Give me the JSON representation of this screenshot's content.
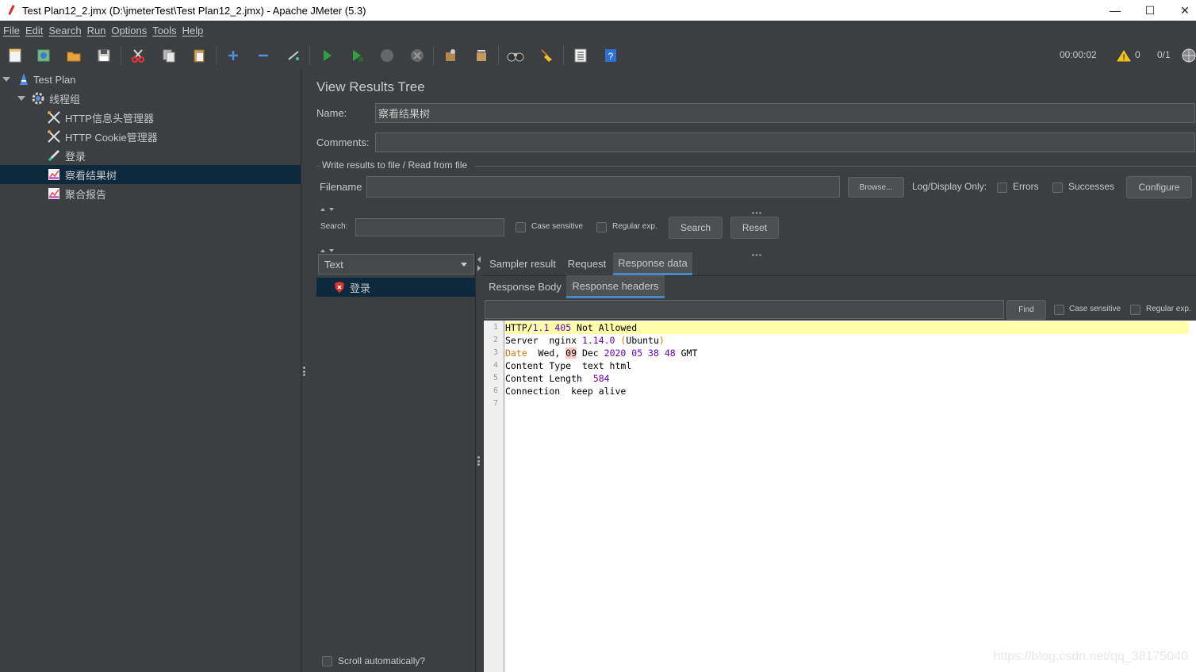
{
  "window": {
    "title": "Test Plan12_2.jmx (D:\\jmeterTest\\Test Plan12_2.jmx) - Apache JMeter (5.3)",
    "minimize": "—",
    "maximize": "☐",
    "close": "✕"
  },
  "menu": [
    "File",
    "Edit",
    "Search",
    "Run",
    "Options",
    "Tools",
    "Help"
  ],
  "toolbar": {
    "elapsed": "00:00:02",
    "warnings": "0",
    "threads": "0/1"
  },
  "tree": {
    "items": [
      {
        "label": "Test Plan",
        "icon": "test-plan-icon"
      },
      {
        "label": "线程组",
        "icon": "thread-group-gear-icon"
      },
      {
        "label": "HTTP信息头管理器",
        "icon": "config-tools-icon"
      },
      {
        "label": "HTTP Cookie管理器",
        "icon": "config-tools-icon"
      },
      {
        "label": "登录",
        "icon": "sampler-pen-icon"
      },
      {
        "label": "察看结果树",
        "icon": "listener-chart-icon"
      },
      {
        "label": "聚合报告",
        "icon": "listener-chart-icon"
      }
    ],
    "selected_index": 5
  },
  "panel": {
    "title": "View Results Tree",
    "name_label": "Name:",
    "name_value": "察看结果树",
    "comments_label": "Comments:",
    "comments_value": "",
    "file_section_label": "Write results to file / Read from file",
    "filename_label": "Filename",
    "filename_value": "",
    "browse_label": "Browse...",
    "log_display_label": "Log/Display Only:",
    "errors_label": "Errors",
    "successes_label": "Successes",
    "configure_label": "Configure"
  },
  "search": {
    "label": "Search:",
    "value": "",
    "case_sensitive_label": "Case sensitive",
    "regex_label": "Regular exp.",
    "search_button": "Search",
    "reset_button": "Reset"
  },
  "results": {
    "renderer": "Text",
    "samples": [
      {
        "label": "登录",
        "status": "error"
      }
    ],
    "scroll_auto_label": "Scroll automatically?"
  },
  "tabs": {
    "main": [
      "Sampler result",
      "Request",
      "Response data"
    ],
    "main_active": "Response data",
    "sub": [
      "Response Body",
      "Response headers"
    ],
    "sub_active": "Response headers"
  },
  "find": {
    "value": "",
    "find_button": "Find",
    "case_sensitive_label": "Case sensitive",
    "regex_label": "Regular exp."
  },
  "response_headers": {
    "line_numbers": [
      "1",
      "2",
      "3",
      "4",
      "5",
      "6",
      "7"
    ],
    "line1": {
      "a": "HTTP/",
      "b": "1.1",
      "c": " ",
      "d": "405",
      "e": " Not Allowed"
    },
    "line2": {
      "a": "Server  nginx ",
      "b": "1.14.0",
      "c": " (",
      "d": "Ubuntu",
      "e": ")"
    },
    "line3": {
      "a": "Date",
      "b": "  Wed, ",
      "c": "09",
      "d": " Dec ",
      "e": "2020 05 38 48",
      "f": " GMT"
    },
    "line4": "Content Type  text html",
    "line5": {
      "a": "Content Length  ",
      "b": "584"
    },
    "line6": "Connection  keep alive"
  },
  "watermark": "https://blog.csdn.net/qq_38175040"
}
